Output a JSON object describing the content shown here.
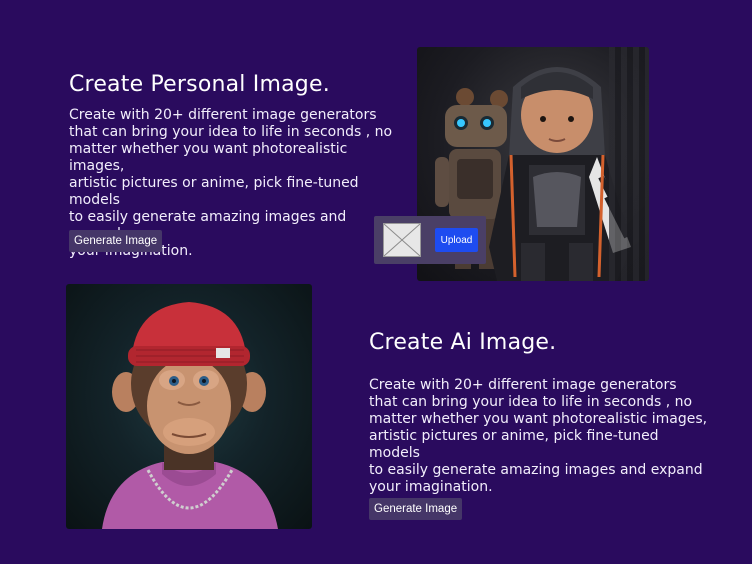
{
  "sections": [
    {
      "title": "Create Personal Image.",
      "body": "Create with 20+  different image generators\nthat can bring your idea to life in seconds , no\nmatter whether you want photorealistic images,\nartistic pictures or anime, pick fine-tuned models\nto easily generate amazing images and expand\nyour imagination.",
      "button_label": "Generate Image",
      "image_alt": "child-with-robot-photo"
    },
    {
      "title": "Create  Ai  Image.",
      "body": "Create with 20+  different image generators\nthat can bring your idea to life in seconds , no\nmatter whether you want photorealistic images,\nartistic pictures or anime, pick fine-tuned models\nto easily generate amazing images and expand\nyour imagination.",
      "button_label": "Generate Image",
      "image_alt": "ape-with-red-beanie-photo"
    }
  ],
  "upload": {
    "button_label": "Upload",
    "thumbnail_icon": "image-placeholder-icon"
  },
  "colors": {
    "background": "#2a0b5e",
    "button": "#453668",
    "upload_button": "#1e4cf0",
    "upload_panel": "#4a3f66",
    "text": "#ffffff"
  }
}
